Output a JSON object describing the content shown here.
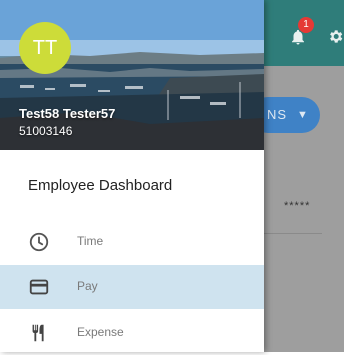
{
  "app_bar": {
    "notification_count": "1",
    "action_button_label": "NS"
  },
  "content": {
    "masked_value": "*****"
  },
  "drawer": {
    "avatar_initials": "TT",
    "user_name": "Test58 Tester57",
    "user_id": "51003146",
    "section_title": "Employee Dashboard",
    "items": [
      {
        "label": "Time",
        "icon": "clock-icon",
        "selected": false
      },
      {
        "label": "Pay",
        "icon": "credit-card-icon",
        "selected": true
      },
      {
        "label": "Expense",
        "icon": "fork-knife-icon",
        "selected": false
      }
    ]
  },
  "colors": {
    "app_bar": "#2f7d7a",
    "avatar": "#cddc39",
    "selected_item": "#cfe3ef",
    "pill_button": "#3f82c6",
    "badge": "#e53935"
  }
}
